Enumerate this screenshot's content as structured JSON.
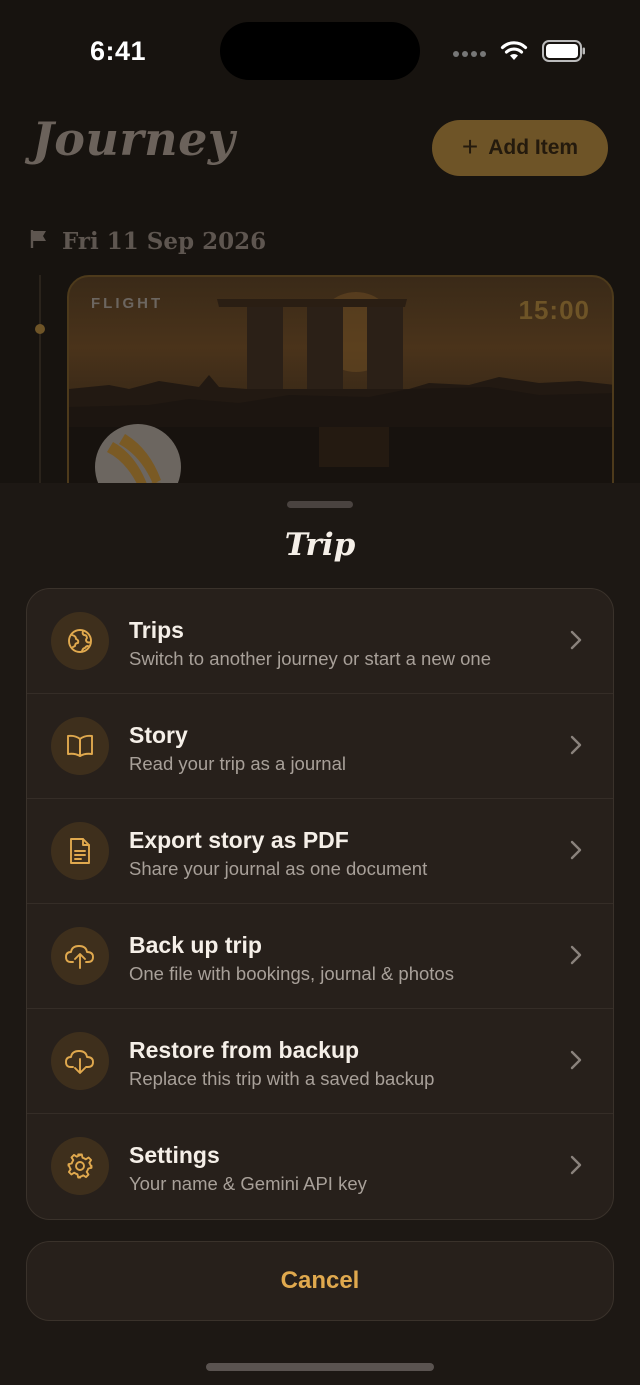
{
  "status_bar": {
    "time": "6:41"
  },
  "header": {
    "title": "Journey",
    "add_button_label": "Add Item"
  },
  "timeline": {
    "day_label": "Fri 11 Sep 2026",
    "card": {
      "type_label": "FLIGHT",
      "time": "15:00"
    }
  },
  "sheet": {
    "title": "Trip",
    "items": [
      {
        "title": "Trips",
        "subtitle": "Switch to another journey or start a new one",
        "icon": "globe-icon"
      },
      {
        "title": "Story",
        "subtitle": "Read your trip as a journal",
        "icon": "book-open-icon"
      },
      {
        "title": "Export story as PDF",
        "subtitle": "Share your journal as one document",
        "icon": "document-icon"
      },
      {
        "title": "Back up trip",
        "subtitle": "One file with bookings, journal & photos",
        "icon": "cloud-upload-icon"
      },
      {
        "title": "Restore from backup",
        "subtitle": "Replace this trip with a saved backup",
        "icon": "cloud-download-icon"
      },
      {
        "title": "Settings",
        "subtitle": "Your name & Gemini API key",
        "icon": "gear-icon"
      }
    ],
    "cancel_label": "Cancel"
  },
  "colors": {
    "accent": "#e0a94e",
    "sheet_bg": "#1d1814",
    "card_bg": "#27201b"
  }
}
